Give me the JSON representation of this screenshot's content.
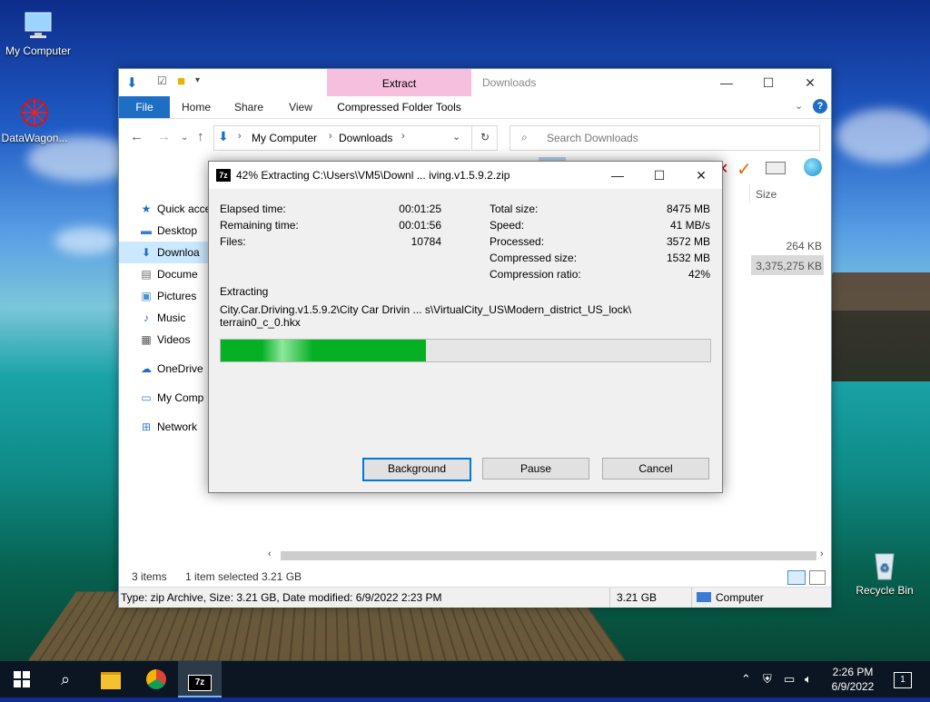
{
  "desktop": {
    "icons": [
      {
        "label": "My Computer",
        "icon": "monitor-icon"
      },
      {
        "label": "DataWagon...",
        "icon": "datawagon-icon"
      },
      {
        "label": "Recycle Bin",
        "icon": "recycle-bin-icon"
      }
    ]
  },
  "explorer": {
    "title": "Downloads",
    "context_tab": "Extract",
    "context_subtab": "Compressed Folder Tools",
    "tabs": [
      "File",
      "Home",
      "Share",
      "View"
    ],
    "address": {
      "root": "My Computer",
      "folder": "Downloads"
    },
    "search_placeholder": "Search Downloads",
    "nav": [
      {
        "label": "Quick acce",
        "icon": "star-icon"
      },
      {
        "label": "Desktop",
        "icon": "desktop-icon"
      },
      {
        "label": "Downloa",
        "icon": "download-icon"
      },
      {
        "label": "Docume",
        "icon": "document-icon"
      },
      {
        "label": "Pictures",
        "icon": "picture-icon"
      },
      {
        "label": "Music",
        "icon": "music-icon"
      },
      {
        "label": "Videos",
        "icon": "video-icon"
      },
      {
        "label": "OneDrive",
        "icon": "cloud-icon"
      },
      {
        "label": "My Comp",
        "icon": "computer-icon"
      },
      {
        "label": "Network",
        "icon": "network-icon"
      }
    ],
    "column_size": "Size",
    "rows": [
      {
        "size": "264 KB"
      },
      {
        "size": "3,375,275 KB"
      }
    ],
    "status": {
      "items": "3 items",
      "selected": "1 item selected",
      "selected_size": "3.21 GB"
    },
    "details": {
      "text": "Type: zip Archive, Size: 3.21 GB, Date modified: 6/9/2022 2:23 PM",
      "size": "3.21 GB",
      "location": "Computer"
    }
  },
  "dialog": {
    "title": "42% Extracting C:\\Users\\VM5\\Downl ... iving.v1.5.9.2.zip",
    "progress": 0.42,
    "left": [
      {
        "label": "Elapsed time:",
        "value": "00:01:25"
      },
      {
        "label": "Remaining time:",
        "value": "00:01:56"
      },
      {
        "label": "Files:",
        "value": "10784"
      }
    ],
    "right": [
      {
        "label": "Total size:",
        "value": "8475 MB"
      },
      {
        "label": "Speed:",
        "value": "41 MB/s"
      },
      {
        "label": "Processed:",
        "value": "3572 MB"
      },
      {
        "label": "Compressed size:",
        "value": "1532 MB"
      },
      {
        "label": "Compression ratio:",
        "value": "42%"
      }
    ],
    "action": "Extracting",
    "path_line1": "City.Car.Driving.v1.5.9.2\\City Car Drivin ... s\\VirtualCity_US\\Modern_district_US_lock\\",
    "path_line2": "terrain0_c_0.hkx",
    "buttons": {
      "background": "Background",
      "pause": "Pause",
      "cancel": "Cancel"
    }
  },
  "taskbar": {
    "time": "2:26 PM",
    "date": "6/9/2022",
    "notification_count": "1",
    "app_7z": "7z"
  }
}
